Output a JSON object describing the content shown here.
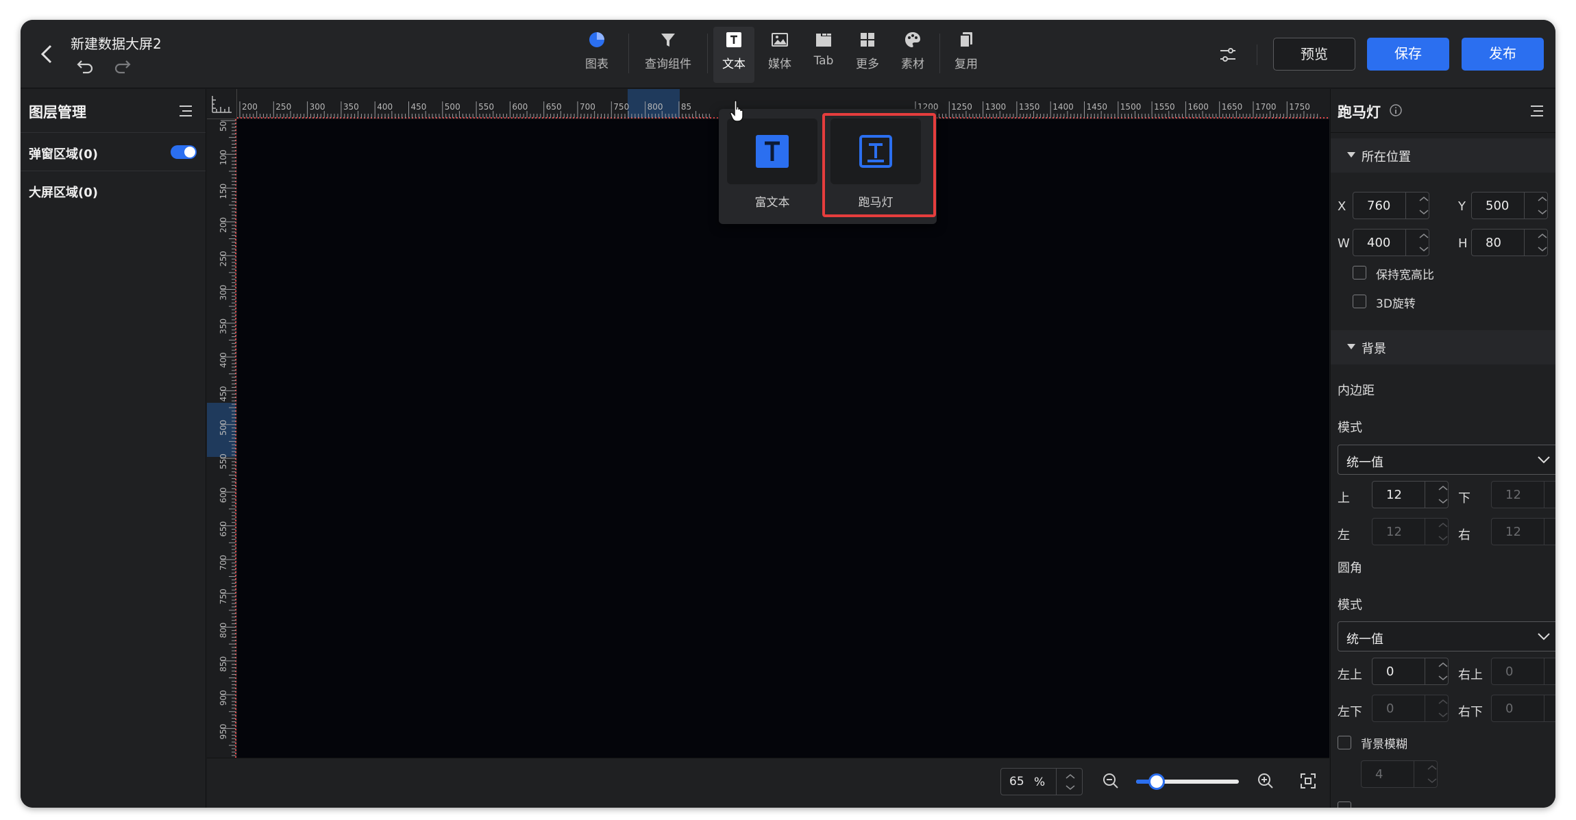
{
  "header": {
    "title": "新建数据大屏2",
    "toolbar": [
      {
        "label": "图表",
        "icon": "pie-chart-icon"
      },
      {
        "label": "查询组件",
        "icon": "filter-icon"
      },
      {
        "label": "文本",
        "icon": "text-icon"
      },
      {
        "label": "媒体",
        "icon": "image-icon"
      },
      {
        "label": "Tab",
        "icon": "tab-icon"
      },
      {
        "label": "更多",
        "icon": "grid-icon"
      },
      {
        "label": "素材",
        "icon": "palette-icon"
      },
      {
        "label": "复用",
        "icon": "copy-icon"
      }
    ],
    "active_tool": "文本",
    "preview_label": "预览",
    "save_label": "保存",
    "publish_label": "发布"
  },
  "left_panel": {
    "title": "图层管理",
    "rows": [
      {
        "label": "弹窗区域(0)",
        "toggle_on": true
      },
      {
        "label": "大屏区域(0)"
      }
    ]
  },
  "ruler": {
    "h_labels": [
      "200",
      "250",
      "300",
      "350",
      "400",
      "450",
      "500",
      "550",
      "600",
      "650",
      "700",
      "750",
      "800",
      "85",
      "1200",
      "1250",
      "1300",
      "1350",
      "1400",
      "1450",
      "1500",
      "1550",
      "1600",
      "1650",
      "1700",
      "1750"
    ],
    "v_labels": [
      "50",
      "100",
      "150",
      "200",
      "250",
      "300",
      "350",
      "400",
      "450",
      "500",
      "550",
      "600",
      "650",
      "700",
      "750",
      "800",
      "850",
      "900",
      "950"
    ]
  },
  "popover": {
    "items": [
      {
        "label": "富文本",
        "icon": "rich-text-icon"
      },
      {
        "label": "跑马灯",
        "icon": "marquee-icon",
        "highlighted": true
      }
    ]
  },
  "bottom_bar": {
    "zoom_value": "65",
    "zoom_unit": "%",
    "zoom_slider_fraction": 0.2
  },
  "right_panel": {
    "title": "跑马灯",
    "position_section": "所在位置",
    "x_label": "X",
    "x_value": "760",
    "y_label": "Y",
    "y_value": "500",
    "w_label": "W",
    "w_value": "400",
    "h_label": "H",
    "h_value": "80",
    "keep_ratio_label": "保持宽高比",
    "rotate3d_label": "3D旋转",
    "background_section": "背景",
    "padding_label": "内边距",
    "padding_mode_label": "模式",
    "padding_mode_value": "统一值",
    "top_label": "上",
    "top_value": "12",
    "bottom_label": "下",
    "bottom_value": "12",
    "left_label": "左",
    "left_value": "12",
    "right_label": "右",
    "right_value": "12",
    "radius_label": "圆角",
    "radius_mode_label": "模式",
    "radius_mode_value": "统一值",
    "tl_label": "左上",
    "tl_value": "0",
    "tr_label": "右上",
    "tr_value": "0",
    "bl_label": "左下",
    "bl_value": "0",
    "br_label": "右下",
    "br_value": "0",
    "blur_label": "背景模糊",
    "blur_value": "4"
  },
  "colors": {
    "accent": "#2b6ff0",
    "highlight": "#e53d3d",
    "ruler_marker": "#e0464a"
  }
}
